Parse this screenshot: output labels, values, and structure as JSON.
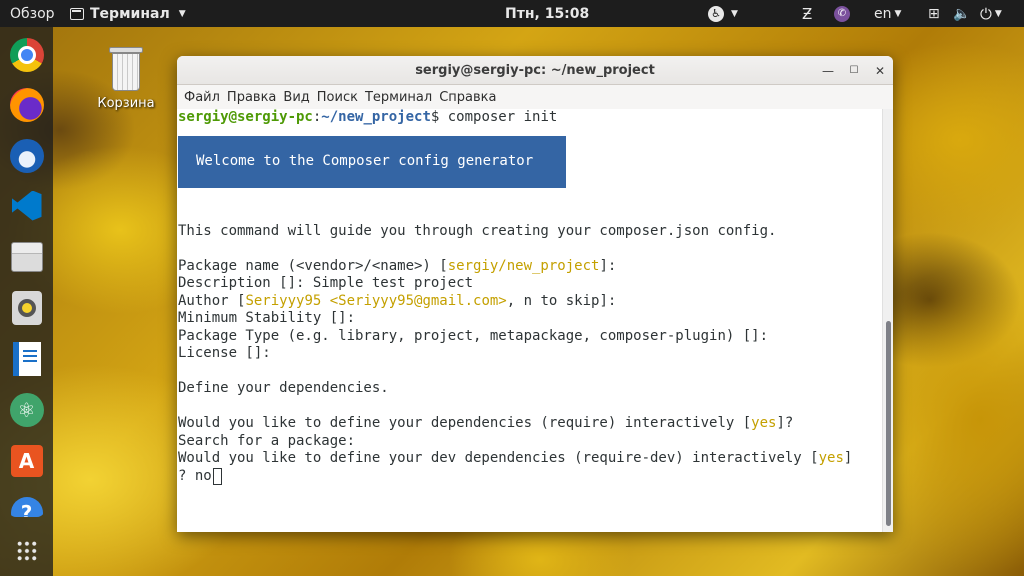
{
  "topbar": {
    "activities": "Обзор",
    "app_name": "Терминал",
    "clock": "Птн, 15:08",
    "language": "en"
  },
  "desktop": {
    "trash_label": "Корзина"
  },
  "dock": {
    "items": [
      "chrome-icon",
      "firefox-icon",
      "thunderbird-icon",
      "vscode-icon",
      "files-icon",
      "rhythmbox-icon",
      "writer-icon",
      "atom-icon",
      "software-store-icon",
      "help-icon",
      "show-apps-icon"
    ]
  },
  "window": {
    "title": "sergiy@sergiy-pc: ~/new_project",
    "menu": [
      "Файл",
      "Правка",
      "Вид",
      "Поиск",
      "Терминал",
      "Справка"
    ]
  },
  "terminal": {
    "prompt_user": "sergiy@sergiy-pc",
    "prompt_sep": ":",
    "prompt_path": "~/new_project",
    "prompt_dollar": "$ ",
    "command": "composer init",
    "banner": "Welcome to the Composer config generator",
    "guide": "This command will guide you through creating your composer.json config.",
    "pkg_name_pre": "Package name (<vendor>/<name>) [",
    "pkg_name_default": "sergiy/new_project",
    "pkg_name_post": "]:",
    "description": "Description []: Simple test project",
    "author_pre": "Author [",
    "author_default": "Seriyyy95 <Seriyyy95@gmail.com>",
    "author_post": ", n to skip]:",
    "min_stability": "Minimum Stability []:",
    "pkg_type": "Package Type (e.g. library, project, metapackage, composer-plugin) []:",
    "license": "License []:",
    "define_deps": "Define your dependencies.",
    "req_pre": "Would you like to define your dependencies (require) interactively [",
    "req_default": "yes",
    "req_post": "]?",
    "search": "Search for a package:",
    "dev_pre": "Would you like to define your dev dependencies (require-dev) interactively [",
    "dev_default": "yes",
    "dev_post": "]",
    "answer_prefix": "? ",
    "answer": "no"
  },
  "colors": {
    "prompt_user": "#4e9a06",
    "prompt_path": "#3465a4",
    "banner_bg": "#3465a4",
    "default_value": "#c4a000"
  }
}
